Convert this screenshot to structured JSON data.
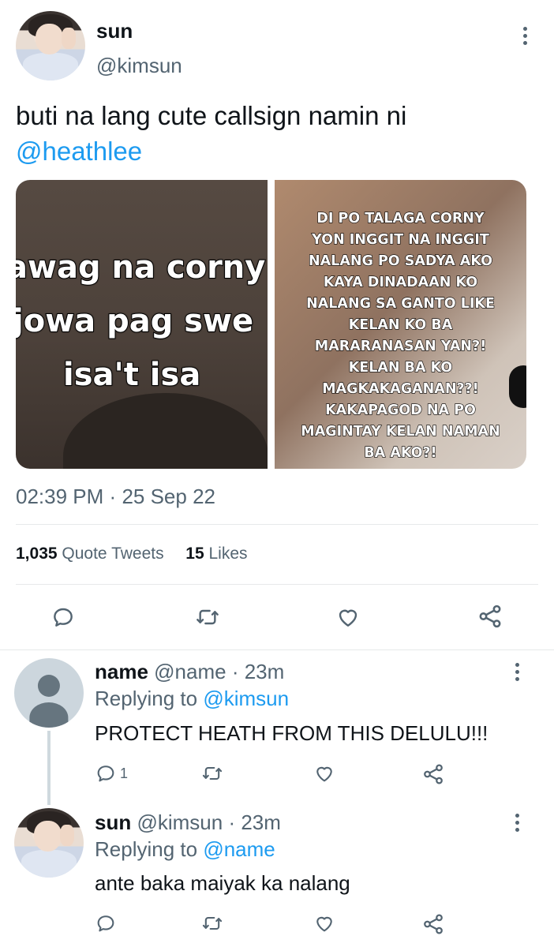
{
  "tweet": {
    "author_name": "sun",
    "author_handle": "@kimsun",
    "text": "buti na lang cute callsign namin ni",
    "mention": "@heathlee",
    "media_left_lines": [
      "awag na corny",
      "jowa pag swe",
      "isa't isa"
    ],
    "media_right_lines": [
      "DI PO TALAGA CORNY",
      "YON INGGIT NA INGGIT",
      "NALANG PO SADYA AKO",
      "KAYA DINADAAN KO",
      "NALANG SA GANTO LIKE",
      "KELAN KO BA",
      "MARARANASAN YAN?!",
      "KELAN BA KO",
      "MAGKAKAGANAN??!",
      "KAKAPAGOD NA PO",
      "MAGINTAY KELAN NAMAN",
      "BA AKO?!"
    ],
    "time": "02:39 PM",
    "separator": "·",
    "date": "25 Sep 22",
    "quote_count": "1,035",
    "quote_label": "Quote Tweets",
    "like_count": "15",
    "like_label": "Likes"
  },
  "replies": [
    {
      "name": "name",
      "handle": "@name",
      "time": "· 23m",
      "replying_label": "Replying to",
      "replying_to": "@kimsun",
      "text": "PROTECT HEATH FROM THIS DELULU!!!",
      "reply_count": "1"
    },
    {
      "name": "sun",
      "handle": "@kimsun",
      "time": "· 23m",
      "replying_label": "Replying to",
      "replying_to": "@name",
      "text": "ante baka maiyak ka nalang",
      "reply_count": ""
    }
  ],
  "icons": {
    "reply": "reply-icon",
    "retweet": "retweet-icon",
    "like": "heart-icon",
    "share": "share-icon",
    "more": "more-icon"
  },
  "colors": {
    "link": "#1d9bf0",
    "secondary_text": "#536471",
    "divider": "#e7e9ea"
  }
}
